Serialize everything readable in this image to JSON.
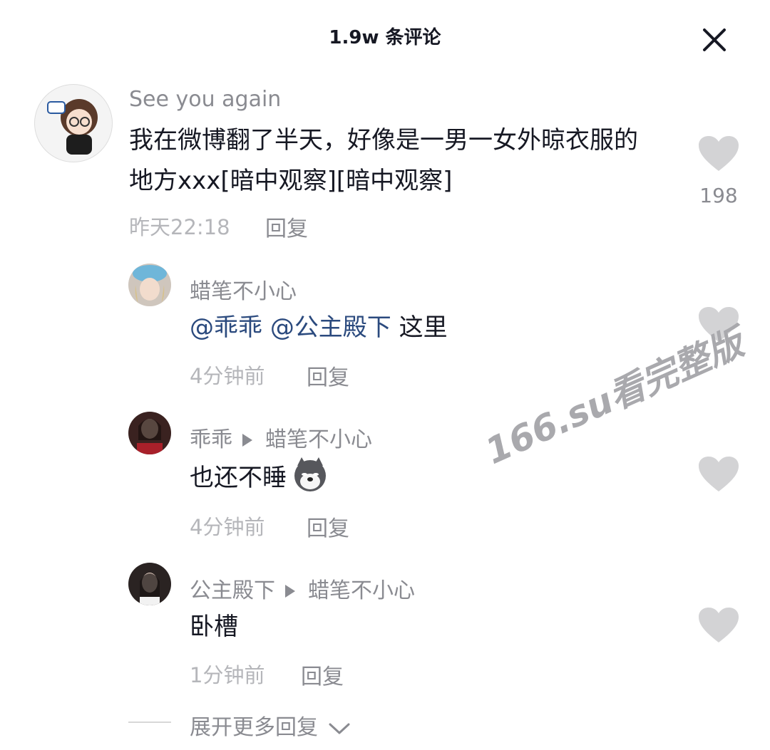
{
  "header": {
    "title": "1.9w 条评论"
  },
  "comment": {
    "username": "See you again",
    "text_line1": "我在微博翻了半天，好像是一男一女外晾衣服的",
    "text_line2": "地方xxx[暗中观察][暗中观察]",
    "time": "昨天22:18",
    "reply_label": "回复",
    "likes": "198"
  },
  "replies": [
    {
      "username": "蜡笔不小心",
      "mention1": "@乖乖",
      "mention2": "@公主殿下",
      "text": " 这里",
      "time": "4分钟前",
      "reply_label": "回复"
    },
    {
      "username": "乖乖",
      "reply_to": "蜡笔不小心",
      "text": "也还不睡",
      "emoji": "dog-emoji",
      "time": "4分钟前",
      "reply_label": "回复"
    },
    {
      "username": "公主殿下",
      "reply_to": "蜡笔不小心",
      "text": "卧槽",
      "time": "1分钟前",
      "reply_label": "回复"
    }
  ],
  "expand_label": "展开更多回复",
  "watermark": "166.su看完整版",
  "icons": [
    "close-icon",
    "heart-icon",
    "chevron-down-icon",
    "play-arrow-icon"
  ],
  "colors": {
    "mention": "#2b4a7e",
    "secondary": "#8a8b91",
    "heart": "#d3d3d5"
  }
}
